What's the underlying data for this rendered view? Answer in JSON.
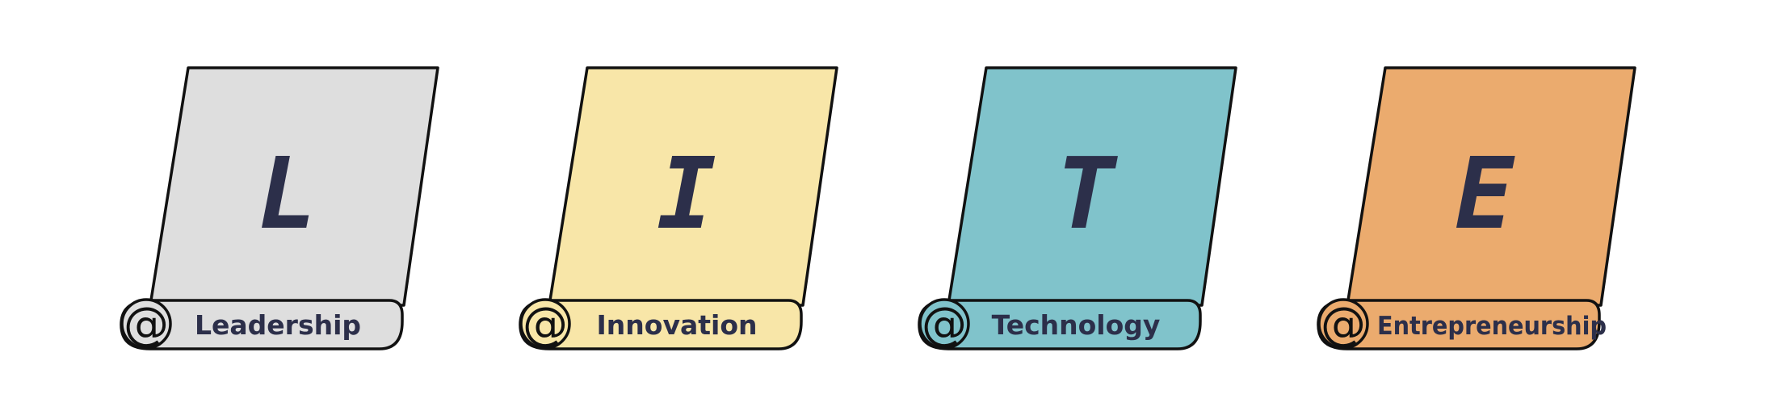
{
  "cards": [
    {
      "letter": "L",
      "label": "Leadership",
      "at_symbol": "@",
      "color": "#dedede"
    },
    {
      "letter": "I",
      "label": "Innovation",
      "at_symbol": "@",
      "color": "#f8e6a8"
    },
    {
      "letter": "T",
      "label": "Technology",
      "at_symbol": "@",
      "color": "#80c3cb"
    },
    {
      "letter": "E",
      "label": "Entrepreneurship",
      "at_symbol": "@",
      "color": "#ebab6e"
    }
  ],
  "colors": {
    "outline": "#111111",
    "text": "#2c2f4a",
    "background": "#ffffff"
  }
}
